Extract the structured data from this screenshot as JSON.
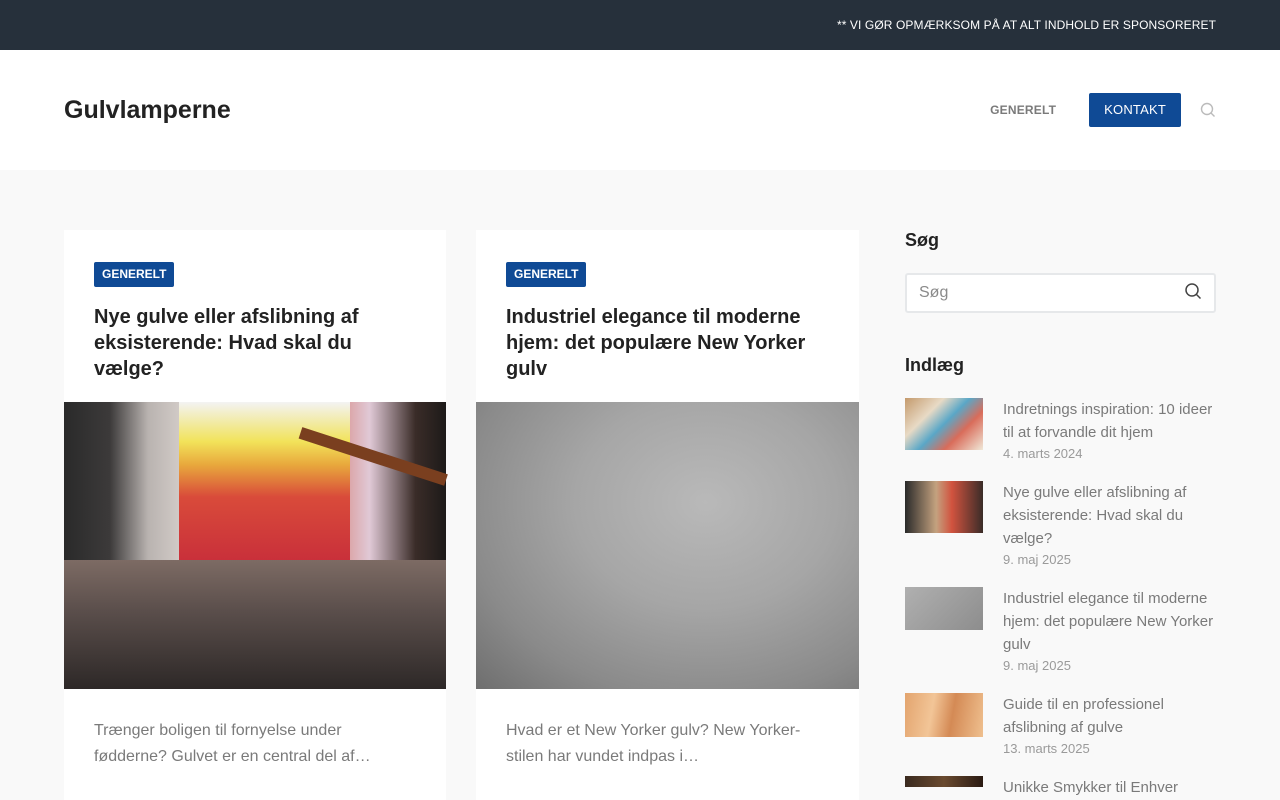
{
  "topbar": {
    "notice": "** VI GØR OPMÆRKSOM PÅ AT ALT INDHOLD ER SPONSORERET"
  },
  "header": {
    "logo": "Gulvlamperne",
    "nav": {
      "generelt": "GENERELT",
      "kontakt": "KONTAKT"
    },
    "search_icon": "search-icon"
  },
  "colors": {
    "accent": "#0f4a95",
    "topbar_bg": "#26303b"
  },
  "cards": [
    {
      "category": "GENERELT",
      "title": "Nye gulve eller afslibning af eksisterende: Hvad skal du vælge?",
      "excerpt": "Trænger boligen til fornyelse under fødderne? Gulvet er en central del af…"
    },
    {
      "category": "GENERELT",
      "title": "Industriel elegance til moderne hjem: det populære New Yorker gulv",
      "excerpt": "Hvad er et New Yorker gulv? New Yorker-stilen har vundet indpas i…"
    }
  ],
  "sidebar": {
    "search_heading": "Søg",
    "search_placeholder": "Søg",
    "posts_heading": "Indlæg",
    "posts": [
      {
        "title": "Indretnings inspiration: 10 ideer til at forvandle dit hjem",
        "date": "4. marts 2024"
      },
      {
        "title": "Nye gulve eller afslibning af eksisterende: Hvad skal du vælge?",
        "date": "9. maj 2025"
      },
      {
        "title": "Industriel elegance til moderne hjem: det populære New Yorker gulv",
        "date": "9. maj 2025"
      },
      {
        "title": "Guide til en professionel afslibning af gulve",
        "date": "13. marts 2025"
      },
      {
        "title": "Unikke Smykker til Enhver",
        "date": ""
      }
    ]
  }
}
